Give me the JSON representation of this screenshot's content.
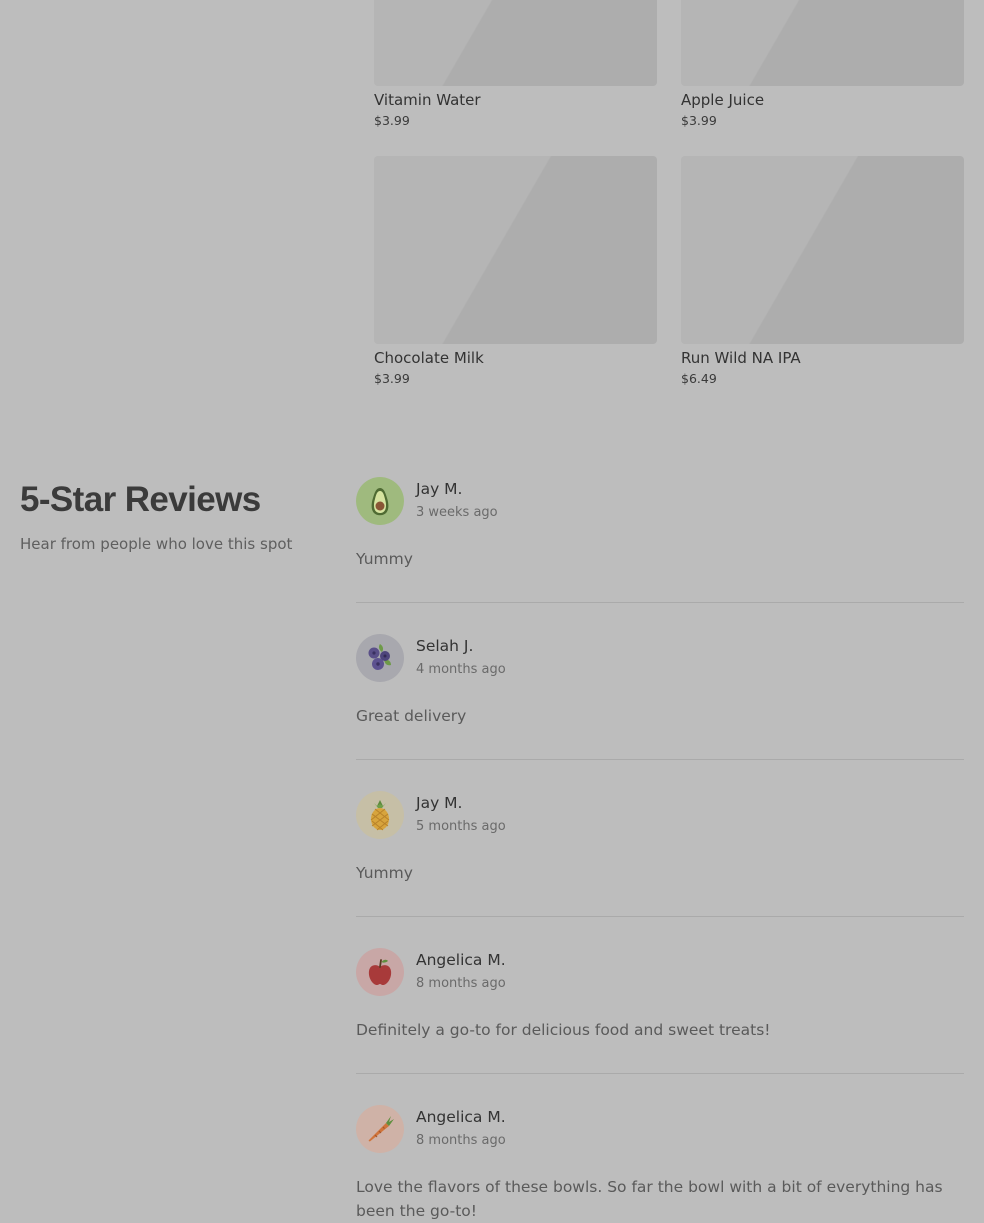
{
  "products": [
    {
      "name": "Vitamin Water",
      "price": "$3.99"
    },
    {
      "name": "Apple Juice",
      "price": "$3.99"
    },
    {
      "name": "Chocolate Milk",
      "price": "$3.99"
    },
    {
      "name": "Run Wild NA IPA",
      "price": "$6.49"
    }
  ],
  "reviews_section": {
    "title": "5-Star Reviews",
    "subtitle": "Hear from people who love this spot"
  },
  "reviews": [
    {
      "avatar_icon": "avocado-icon",
      "name": "Jay M.",
      "date": "3 weeks ago",
      "text": "Yummy"
    },
    {
      "avatar_icon": "blueberries-icon",
      "name": "Selah J.",
      "date": "4 months ago",
      "text": "Great delivery"
    },
    {
      "avatar_icon": "pineapple-icon",
      "name": "Jay M.",
      "date": "5 months ago",
      "text": "Yummy"
    },
    {
      "avatar_icon": "apple-icon",
      "name": "Angelica M.",
      "date": "8 months ago",
      "text": "Definitely a go-to for delicious food and sweet treats!"
    },
    {
      "avatar_icon": "carrot-icon",
      "name": "Angelica M.",
      "date": "8 months ago",
      "text": "Love the flavors of these bowls. So far the bowl with a bit of everything has been the go-to!"
    }
  ],
  "colors": {
    "page_background": "#bdbdbd",
    "image_placeholder": "#b0b0b0",
    "divider": "#aaaaaa"
  }
}
